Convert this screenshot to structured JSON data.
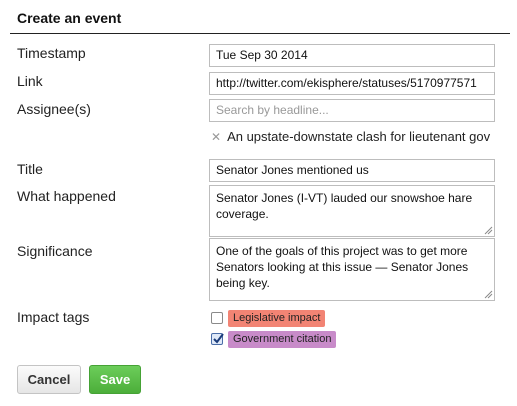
{
  "form": {
    "title": "Create an event",
    "fields": {
      "timestamp": {
        "label": "Timestamp",
        "value": "Tue Sep 30 2014"
      },
      "link": {
        "label": "Link",
        "value": "http://twitter.com/ekisphere/statuses/5170977571"
      },
      "assignees": {
        "label": "Assignee(s)",
        "placeholder": "Search by headline...",
        "selected": [
          "An upstate-downstate clash for lieutenant gov"
        ]
      },
      "title": {
        "label": "Title",
        "value": "Senator Jones mentioned us"
      },
      "what_happened": {
        "label": "What happened",
        "value": "Senator Jones (I-VT) lauded our snowshoe hare coverage."
      },
      "significance": {
        "label": "Significance",
        "value": "One of the goals of this project was to get more Senators looking at this issue — Senator Jones being key."
      },
      "impact_tags": {
        "label": "Impact tags",
        "options": [
          {
            "label": "Legislative impact",
            "checked": false,
            "color": "#f28474"
          },
          {
            "label": "Government citation",
            "checked": true,
            "color": "#c88bc9"
          }
        ]
      }
    },
    "buttons": {
      "cancel": "Cancel",
      "save": "Save"
    },
    "icons": {
      "remove_assignee": "close-icon",
      "checkmark": "check-icon",
      "resize": "resize-grip-icon"
    }
  }
}
